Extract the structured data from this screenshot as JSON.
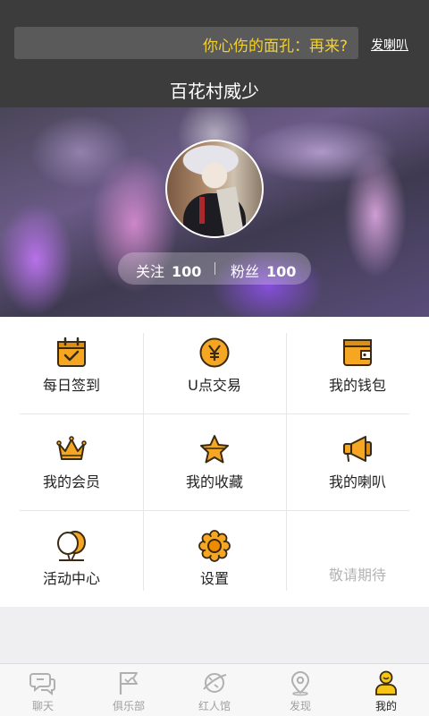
{
  "header": {
    "announcement": "你心伤的面孔：再来?",
    "announce_action": "发喇叭",
    "username": "百花村威少"
  },
  "profile": {
    "stats": [
      {
        "label": "关注",
        "value": "100"
      },
      {
        "label": "粉丝",
        "value": "100"
      }
    ]
  },
  "menu": {
    "items": [
      {
        "label": "每日签到",
        "icon": "calendar-check-icon"
      },
      {
        "label": "U点交易",
        "icon": "yen-coin-icon"
      },
      {
        "label": "我的钱包",
        "icon": "wallet-icon"
      },
      {
        "label": "我的会员",
        "icon": "crown-icon"
      },
      {
        "label": "我的收藏",
        "icon": "star-icon"
      },
      {
        "label": "我的喇叭",
        "icon": "megaphone-icon"
      },
      {
        "label": "活动中心",
        "icon": "balloons-icon"
      },
      {
        "label": "设置",
        "icon": "gear-flower-icon"
      },
      {
        "label": "敬请期待",
        "icon": ""
      }
    ]
  },
  "tabbar": {
    "tabs": [
      {
        "label": "聊天",
        "icon": "chat-bubbles-icon"
      },
      {
        "label": "俱乐部",
        "icon": "flag-icon"
      },
      {
        "label": "红人馆",
        "icon": "planet-icon"
      },
      {
        "label": "发现",
        "icon": "location-pin-icon"
      },
      {
        "label": "我的",
        "icon": "person-icon"
      }
    ],
    "active_index": 4
  },
  "colors": {
    "accent_orange": "#f5a623",
    "accent_yellow": "#f4d12a",
    "header_bg": "#3c3c3c"
  }
}
